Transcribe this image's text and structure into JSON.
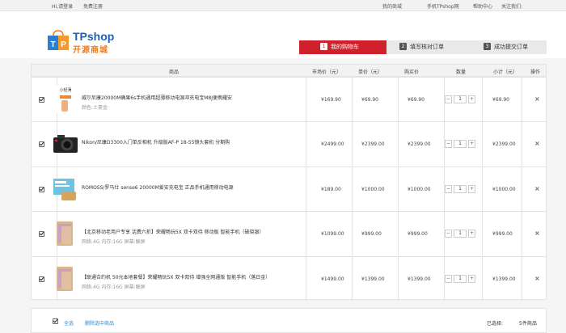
{
  "topbar": {
    "greeting": "Hi,请登录",
    "register": "免费注册",
    "my_mall": "我的商城",
    "mobile": "手机TPshop网",
    "help": "帮助中心",
    "follow": "关注我们:"
  },
  "logo": {
    "brand": "TPshop",
    "subtitle": "开源商城",
    "bag_letters": "TP"
  },
  "steps": [
    {
      "num": "1",
      "label": "我的购物车",
      "active": true
    },
    {
      "num": "2",
      "label": "填写核对订单",
      "active": false
    },
    {
      "num": "3",
      "label": "成功提交订单",
      "active": false
    }
  ],
  "table_headers": {
    "product": "商品",
    "market_price": "市场价（元）",
    "unit_price": "单价（元）",
    "purchase_price": "购买价",
    "quantity": "数量",
    "subtotal": "小计（元）",
    "action": "操作"
  },
  "items": [
    {
      "name": "威尔尼康20000M确果6s手机通用超薄移动电源冲充电宝M8J便携耀安",
      "spec": "颜色:土豪金",
      "market_price": "¥169.90",
      "unit_price": "¥69.90",
      "purchase_price": "¥69.90",
      "quantity": "1",
      "subtotal": "¥69.90",
      "thumb": "power-bank-thumbnail",
      "thumb_text": "小轻薄"
    },
    {
      "name": "Nikon/尼康D3300入门单反相机 升级版AF-P 18-55镜头套机 分期购",
      "spec": "",
      "market_price": "¥2499.00",
      "unit_price": "¥2399.00",
      "purchase_price": "¥2399.00",
      "quantity": "1",
      "subtotal": "¥2399.00",
      "thumb": "camera-thumbnail",
      "thumb_text": ""
    },
    {
      "name": "ROMOSS/罗马仕 sense6 20000M爱安充电宝 正品手机通用移动电源",
      "spec": "",
      "market_price": "¥189.00",
      "unit_price": "¥1000.00",
      "purchase_price": "¥1000.00",
      "quantity": "1",
      "subtotal": "¥1000.00",
      "thumb": "romoss-power-bank-thumbnail",
      "thumb_text": ""
    },
    {
      "name": "【北京移动老用户专享 话费六折】荣耀畅玩5X 双卡双待 移动版 智能手机（破晓银）",
      "spec": "网络:4G 内存:16G 屏幕:触屏",
      "market_price": "¥1099.00",
      "unit_price": "¥999.00",
      "purchase_price": "¥999.00",
      "quantity": "1",
      "subtotal": "¥999.00",
      "thumb": "phone-thumbnail",
      "thumb_text": ""
    },
    {
      "name": "【联通合约机 50元本地套餐】荣耀畅玩5X 双卡双待 增强全网通版 智能手机（落日金）",
      "spec": "网络:4G 内存:16G 屏幕:触屏",
      "market_price": "¥1499.00",
      "unit_price": "¥1399.00",
      "purchase_price": "¥1399.00",
      "quantity": "1",
      "subtotal": "¥1399.00",
      "thumb": "phone-thumbnail",
      "thumb_text": ""
    }
  ],
  "footer": {
    "select_all": "全选",
    "delete_selected": "删除选中商品",
    "selected_label": "已选择:",
    "selected_count": "5件商品"
  },
  "colors": {
    "accent_red": "#d0202c",
    "link_blue": "#2a8ad4",
    "brand_blue": "#1a62b8",
    "brand_orange": "#f07b1b"
  }
}
